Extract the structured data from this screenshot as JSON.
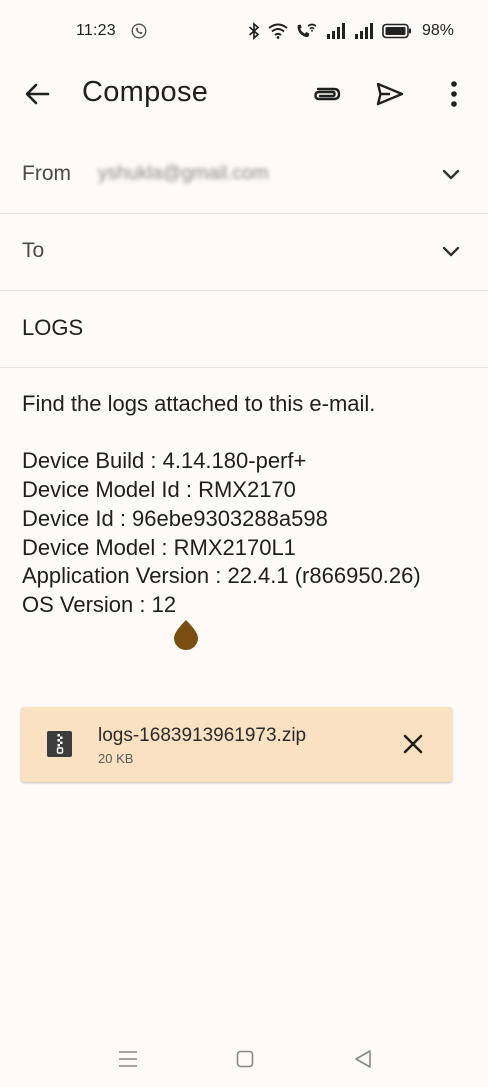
{
  "status_bar": {
    "time": "11:23",
    "battery_percent": "98%",
    "icons": [
      "call-icon",
      "bluetooth-icon",
      "wifi-icon",
      "wifi-calling-icon",
      "signal-icon",
      "signal-icon",
      "battery-icon"
    ]
  },
  "toolbar": {
    "title": "Compose",
    "icons": [
      "back-arrow-icon",
      "attach-icon",
      "send-icon",
      "more-vert-icon"
    ]
  },
  "from": {
    "label": "From",
    "value": "yshukla@gmail.com"
  },
  "to": {
    "label": "To",
    "value": ""
  },
  "subject": {
    "value": "LOGS"
  },
  "body": {
    "intro": "Find the logs attached to this e-mail.",
    "lines": [
      "Device Build : 4.14.180-perf+",
      "Device Model Id : RMX2170",
      "Device Id : 96ebe9303288a598",
      "Device Model : RMX2170L1",
      "Application Version : 22.4.1 (r866950.26)",
      "OS Version : 12"
    ]
  },
  "attachment": {
    "filename": "logs-1683913961973.zip",
    "size": "20 KB",
    "icon": "zip-file-icon"
  },
  "nav_bar": {
    "icons": [
      "menu-icon",
      "home-icon",
      "back-icon"
    ]
  },
  "colors": {
    "background": "#fdfaf7",
    "attachment_background": "#f9e1c1",
    "cursor_handle": "#7a4e12",
    "text": "#1f1f1f"
  }
}
